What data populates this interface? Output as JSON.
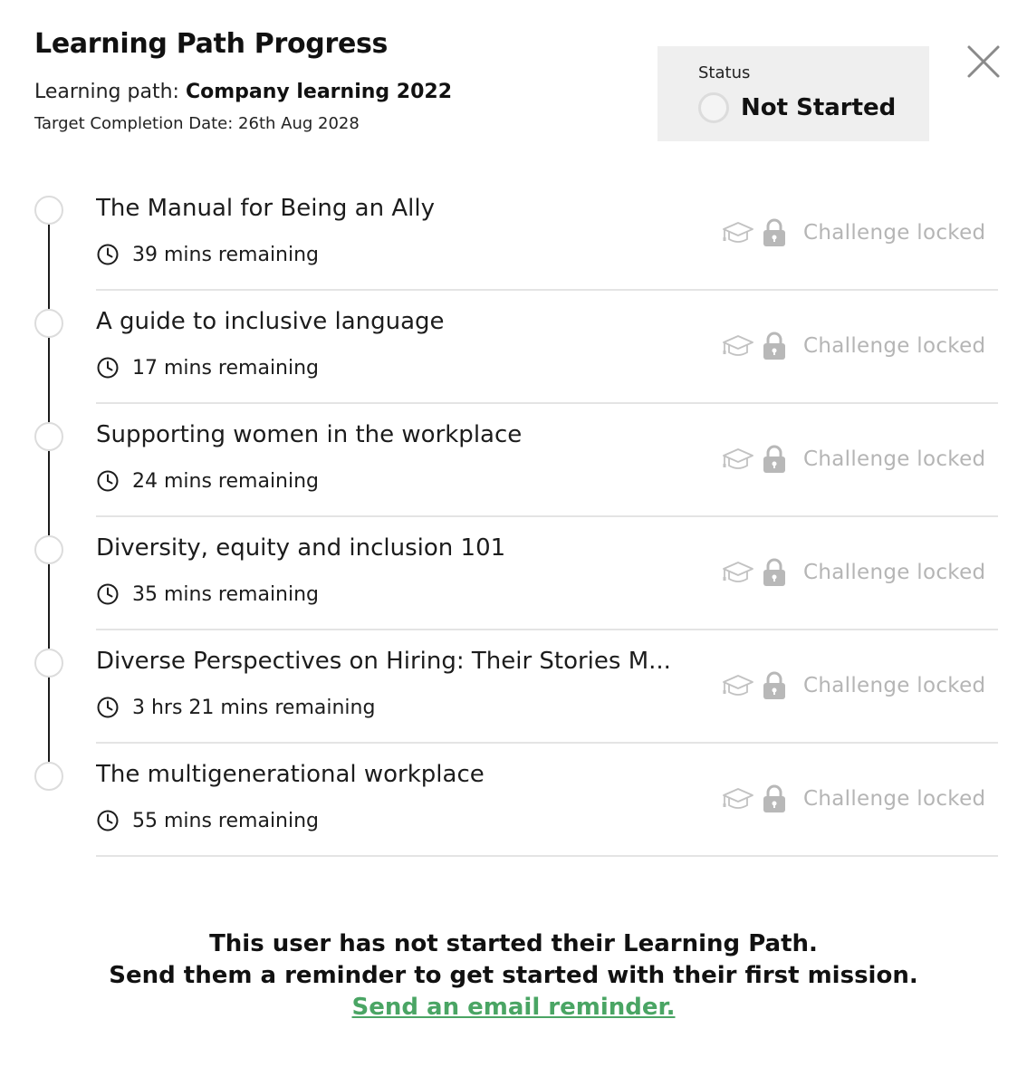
{
  "header": {
    "title": "Learning Path Progress",
    "path_prefix": "Learning path: ",
    "path_name": "Company learning 2022",
    "target_date": "Target Completion Date: 26th Aug 2028"
  },
  "status": {
    "label": "Status",
    "value": "Not Started"
  },
  "close_icon": "close-icon",
  "missions": [
    {
      "title": "The Manual for Being an Ally",
      "time": "39 mins remaining",
      "challenge": "Challenge locked"
    },
    {
      "title": "A guide to inclusive language",
      "time": "17 mins remaining",
      "challenge": "Challenge locked"
    },
    {
      "title": "Supporting women in the workplace",
      "time": "24 mins remaining",
      "challenge": "Challenge locked"
    },
    {
      "title": "Diversity, equity and inclusion 101",
      "time": "35 mins remaining",
      "challenge": "Challenge locked"
    },
    {
      "title": "Diverse Perspectives on Hiring: Their Stories M...",
      "time": "3 hrs 21 mins remaining",
      "challenge": "Challenge locked"
    },
    {
      "title": "The multigenerational workplace",
      "time": "55 mins remaining",
      "challenge": "Challenge locked"
    }
  ],
  "footer": {
    "line1": "This user has not started their Learning Path.",
    "line2": "Send them a reminder to get started with their first mission.",
    "link": "Send an email reminder."
  },
  "colors": {
    "link": "#4aa564",
    "locked_text": "#b5b5b5",
    "status_bg": "#efefef"
  }
}
